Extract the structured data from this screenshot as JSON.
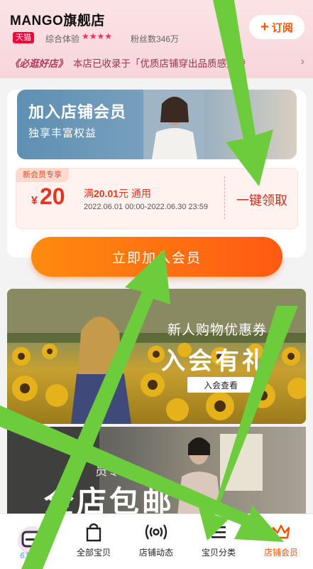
{
  "header": {
    "store_name": "MANGO旗舰店",
    "subscribe_label": "订阅",
    "tmall_badge": "天猫",
    "rating_label": "综合体验",
    "stars": "★★★★",
    "fans": "粉丝数346万",
    "notice_tag": "《必逛好店》",
    "notice_text": "本店已收录于「优质店铺穿出品质感」榜"
  },
  "member": {
    "banner_title": "加入店铺会员",
    "banner_subtitle": "独享丰富权益",
    "coupon": {
      "tag": "新会员专享",
      "currency": "¥",
      "amount": "20",
      "condition_prefix": "满",
      "condition_amount": "20.01",
      "condition_suffix": "元 通用",
      "date_range": "2022.06.01 00:00-2022.06.30 23:59",
      "claim_label": "一键领取"
    },
    "join_label": "立即加入会员"
  },
  "promos": {
    "first": {
      "title": "新人购物优惠券",
      "big": "入会有礼",
      "button": "入会查看"
    },
    "second": {
      "small": "员专",
      "big": "全店包邮"
    }
  },
  "tabbar": {
    "items": [
      {
        "label": "全部宝贝",
        "icon": "bag-icon"
      },
      {
        "label": "店铺动态",
        "icon": "broadcast-icon"
      },
      {
        "label": "宝贝分类",
        "icon": "list-icon"
      },
      {
        "label": "店铺会员",
        "icon": "crown-icon"
      }
    ],
    "logo_text": "618"
  },
  "colors": {
    "accent": "#ff5000",
    "coupon_red": "#e8331e",
    "arrow_green": "#6ccc3c"
  }
}
